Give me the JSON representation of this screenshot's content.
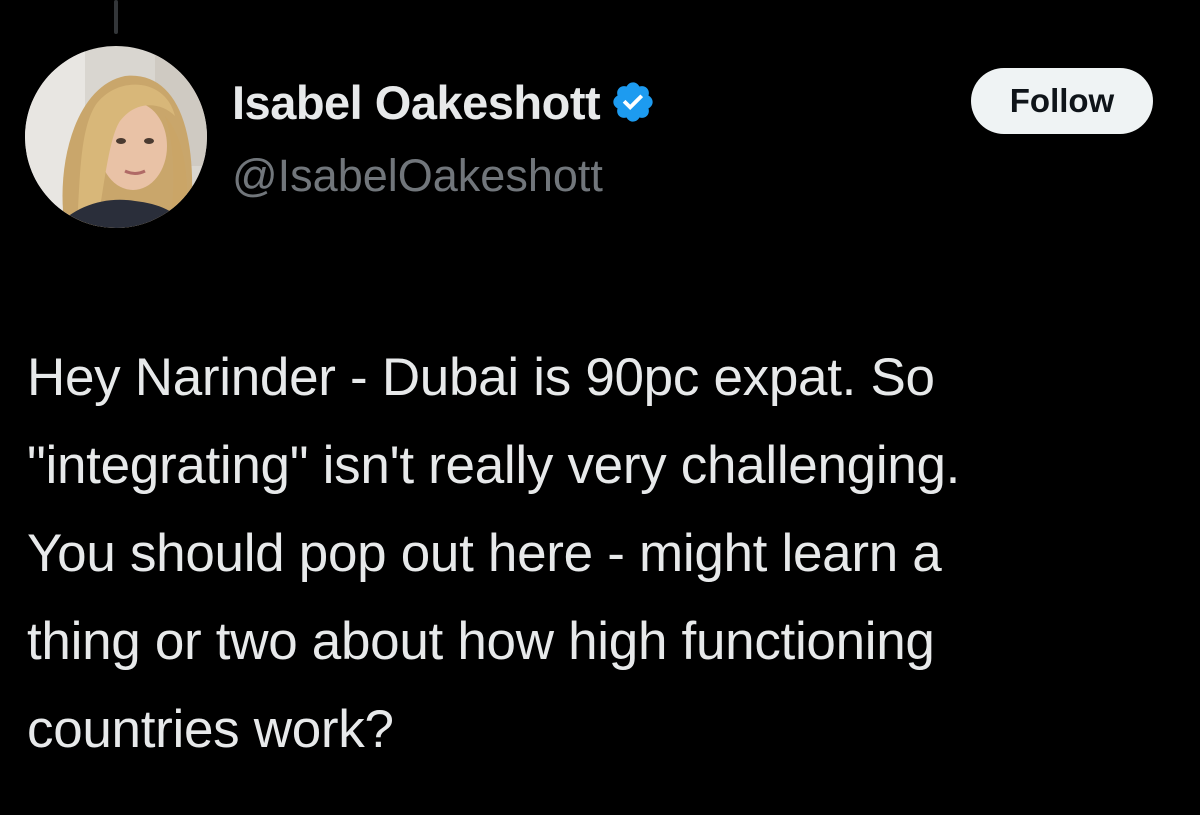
{
  "author": {
    "display_name": "Isabel Oakeshott",
    "handle": "@IsabelOakeshott",
    "verified": true,
    "avatar_icon": "profile-photo"
  },
  "follow_button": {
    "label": "Follow"
  },
  "tweet": {
    "lines": [
      "Hey Narinder - Dubai is 90pc expat. So",
      "\"integrating\" isn't really very challenging.",
      "You should pop out here - might learn a",
      "thing or two about how high functioning",
      "countries work?"
    ]
  },
  "colors": {
    "background": "#000000",
    "text_primary": "#e7e9ea",
    "text_secondary": "#71767b",
    "verified_badge": "#1d9bf0",
    "button_bg": "#eff3f4",
    "button_text": "#0f1419"
  }
}
